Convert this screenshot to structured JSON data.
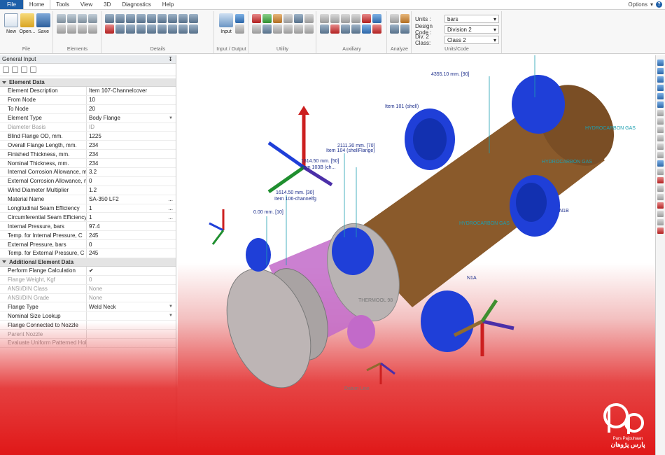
{
  "menu": {
    "file": "File",
    "tabs": [
      "Home",
      "Tools",
      "View",
      "3D",
      "Diagnostics",
      "Help"
    ],
    "options": "Options",
    "help_glyph": "?"
  },
  "ribbon": {
    "groups": {
      "file": "File",
      "elements": "Elements",
      "details": "Details",
      "io": "Input / Output",
      "utility": "Utility",
      "auxiliary": "Auxiliary",
      "analyze": "Analyze",
      "units": "Units/Code"
    },
    "buttons": {
      "new": "New",
      "open": "Open...",
      "save": "Save",
      "input": "Input"
    },
    "units": {
      "units_label": "Units :",
      "units_value": "bars",
      "code_label": "Design Code :",
      "code_value": "Division 2",
      "class_label": "Div. 2 Class:",
      "class_value": "Class 2"
    }
  },
  "panel": {
    "title": "General Input",
    "pin": "↧",
    "section1": "Element Data",
    "rows1": [
      {
        "label": "Element Description",
        "value": "Item 107-Channelcover"
      },
      {
        "label": "From Node",
        "value": "10"
      },
      {
        "label": "To Node",
        "value": "20"
      },
      {
        "label": "Element Type",
        "value": "Body Flange",
        "dd": true
      },
      {
        "label": "Diameter Basis",
        "value": "ID",
        "dim": true
      },
      {
        "label": "Blind Flange OD, mm.",
        "value": "1225"
      },
      {
        "label": "Overall Flange Length, mm.",
        "value": "234"
      },
      {
        "label": "Finished Thickness, mm.",
        "value": "234"
      },
      {
        "label": "Nominal Thickness, mm.",
        "value": "234"
      },
      {
        "label": "Internal Corrosion Allowance, mm.",
        "value": "3.2"
      },
      {
        "label": "External Corrosion Allowance, mm.",
        "value": "0"
      },
      {
        "label": "Wind Diameter Multiplier",
        "value": "1.2"
      },
      {
        "label": "Material Name",
        "value": "SA-350 LF2",
        "more": "..."
      },
      {
        "label": "Longitudinal Seam Efficiency",
        "value": "1",
        "more": "..."
      },
      {
        "label": "Circumferential Seam Efficiency",
        "value": "1",
        "more": "..."
      },
      {
        "label": "Internal Pressure, bars",
        "value": "97.4"
      },
      {
        "label": "Temp. for Internal Pressure, C",
        "value": "245"
      },
      {
        "label": "External Pressure, bars",
        "value": "0"
      },
      {
        "label": "Temp. for External Pressure, C",
        "value": "245"
      }
    ],
    "section2": "Additional Element Data",
    "rows2": [
      {
        "label": "Perform Flange Calculation",
        "value": "✔"
      },
      {
        "label": "Flange Weight, Kgf",
        "value": "0",
        "dim": true
      },
      {
        "label": "ANSI/DIN Class",
        "value": "None",
        "dim": true
      },
      {
        "label": "ANSI/DIN Grade",
        "value": "None",
        "dim": true
      },
      {
        "label": "Flange Type",
        "value": "Weld Neck",
        "dd": true
      },
      {
        "label": "Nominal Size Lookup",
        "value": "",
        "dd": true
      },
      {
        "label": "Flange Connected to Nozzle",
        "value": ""
      },
      {
        "label": "Parent Nozzle",
        "value": "",
        "dim": true
      },
      {
        "label": "Evaluate Uniform Patterned Holes?",
        "value": "",
        "dim": true
      }
    ]
  },
  "viewport": {
    "labels": {
      "l1": "4355.10 mm.  [90]",
      "l2": "Item 101 (shell)",
      "l3": "2111.30 mm.  [70]",
      "l4": "Item 104 (shellFlange)",
      "l5": "1614.50 mm.  [50]",
      "l6": "Item 103B (ch...",
      "l7": "1614.50 mm.  [30]",
      "l8": "Item 106-channelfg",
      "l9": "0.00 mm.  [10]",
      "l10": "HYDROCARBON GAS",
      "l11": "HYDROCARBON GAS",
      "l12": "HYDROCARBON GAS",
      "l13": "N1B",
      "l14": "N1A",
      "l15": "THERMOOL 98",
      "l16": "Datum Line"
    }
  },
  "logo": {
    "latin": "Pars Pajouhaan",
    "persian": "پارس پژوهان"
  },
  "colors": {
    "file_tab": "#1e5fa8",
    "shell": "#8a5a2b",
    "nozzle": "#1f3fd8",
    "channel": "#c26ac9",
    "gradient_red": "#e01818"
  }
}
